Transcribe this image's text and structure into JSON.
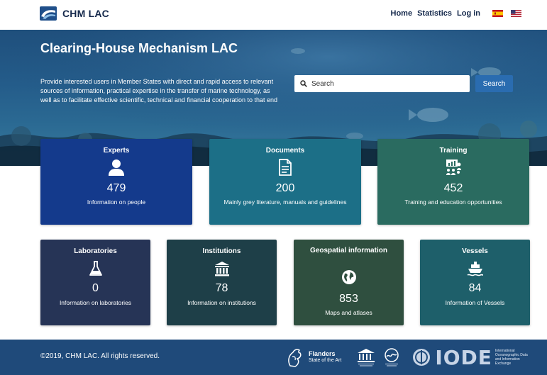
{
  "header": {
    "brand": "CHM LAC",
    "nav": [
      {
        "label": "Home"
      },
      {
        "label": "Statistics"
      },
      {
        "label": "Log in"
      }
    ],
    "flags": [
      "spain-flag-icon",
      "us-flag-icon"
    ]
  },
  "hero": {
    "title": "Clearing-House Mechanism LAC",
    "description": "Provide interested users in Member States with direct and rapid access to relevant sources of information, practical expertise in the transfer of marine technology, as well as to facilitate effective scientific, technical and financial cooperation to that end",
    "search_placeholder": "Search",
    "search_button": "Search"
  },
  "cards": {
    "experts": {
      "title": "Experts",
      "count": "479",
      "desc": "Information on people",
      "icon": "person-icon"
    },
    "documents": {
      "title": "Documents",
      "count": "200",
      "desc": "Mainly grey literature, manuals and guidelines",
      "icon": "document-icon"
    },
    "training": {
      "title": "Training",
      "count": "452",
      "desc": "Training and education opportunities",
      "icon": "training-icon"
    },
    "laboratories": {
      "title": "Laboratories",
      "count": "0",
      "desc": "Information on laboratories",
      "icon": "flask-icon"
    },
    "institutions": {
      "title": "Institutions",
      "count": "78",
      "desc": "Information on institutions",
      "icon": "institution-icon"
    },
    "geospatial": {
      "title": "Geospatial information",
      "count": "853",
      "desc": "Maps and atlases",
      "icon": "globe-icon"
    },
    "vessels": {
      "title": "Vessels",
      "count": "84",
      "desc": "Information of Vessels",
      "icon": "ship-icon"
    }
  },
  "footer": {
    "copyright": "©2019, CHM LAC. All rights reserved.",
    "flanders_name": "Flanders",
    "flanders_tagline": "State of the Art",
    "iode_caption": "International Oceanographic Data and Information Exchange",
    "iode_mark": "IODE"
  },
  "colors": {
    "brand": "#14284b",
    "experts": "#143a8c",
    "documents": "#1c6f87",
    "training": "#2a6b60",
    "laboratories": "#263456",
    "institutions": "#1e3f48",
    "geospatial": "#2f4f3f",
    "vessels": "#1e5f6a",
    "footer": "#1f4a7a",
    "search_button": "#2a6cb0"
  }
}
